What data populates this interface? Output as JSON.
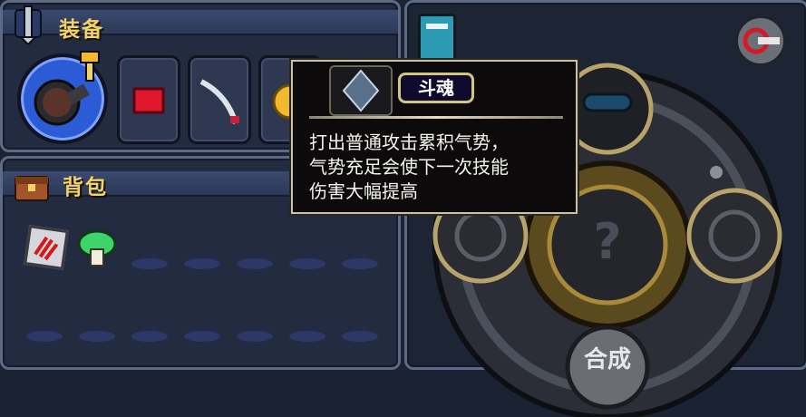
{
  "equipment": {
    "title": "装备"
  },
  "backpack": {
    "title": "背包"
  },
  "tooltip": {
    "item_name": "斗魂",
    "description_lines": [
      "打出普通攻击累积气势，",
      "气势充足会使下一次技能",
      "伤害大幅提高"
    ]
  },
  "crafting": {
    "center_label": "合成"
  },
  "colors": {
    "title_gold": "#f2d36b",
    "panel_header": "#33426a",
    "tooltip_border": "#c9c2a8",
    "badge_bg": "#0e0b2c"
  },
  "icons": {
    "equipment": "helmet-icon",
    "backpack": "chest-icon",
    "journal": "book-icon",
    "exit": "exit-arrow-icon"
  }
}
